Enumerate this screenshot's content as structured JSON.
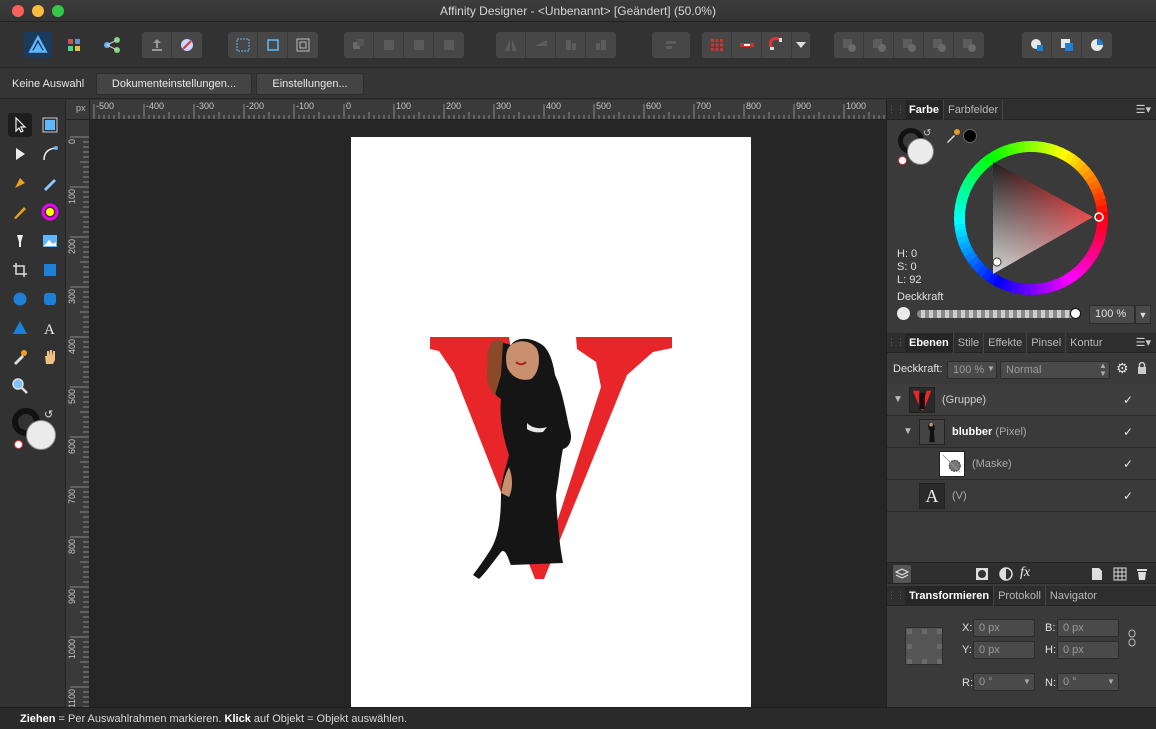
{
  "window": {
    "title": "Affinity Designer - <Unbenannt> [Geändert] (50.0%)"
  },
  "context_bar": {
    "selection_label": "Keine Auswahl",
    "doc_settings_button": "Dokumenteinstellungen...",
    "settings_button": "Einstellungen..."
  },
  "rulers": {
    "unit": "px",
    "top_ticks": [
      "-500",
      "-400",
      "-300",
      "-200",
      "-100",
      "0",
      "100",
      "200",
      "300",
      "400",
      "500",
      "600",
      "700",
      "800",
      "900",
      "1000"
    ],
    "left_ticks": [
      "0",
      "100",
      "200",
      "300",
      "400",
      "500",
      "600",
      "700",
      "800",
      "900",
      "1000",
      "1100"
    ]
  },
  "color_panel": {
    "tabs": [
      "Farbe",
      "Farbfelder"
    ],
    "h": "H: 0",
    "s": "S: 0",
    "l": "L: 92",
    "opacity_label": "Deckkraft",
    "opacity_value": "100 %"
  },
  "layers_panel": {
    "tabs": [
      "Ebenen",
      "Stile",
      "Effekte",
      "Pinsel",
      "Kontur"
    ],
    "opacity_label": "Deckkraft:",
    "opacity_value": "100 %",
    "blend_mode": "Normal",
    "layers": [
      {
        "name": "(Gruppe)",
        "bold": "",
        "type": ""
      },
      {
        "name": "",
        "bold": "blubber",
        "type": "(Pixel)"
      },
      {
        "name": "(Maske)",
        "bold": "",
        "type": ""
      },
      {
        "name": "(V)",
        "bold": "",
        "type": ""
      }
    ]
  },
  "transform_panel": {
    "tabs": [
      "Transformieren",
      "Protokoll",
      "Navigator"
    ],
    "x_label": "X:",
    "x_value": "0 px",
    "y_label": "Y:",
    "y_value": "0 px",
    "b_label": "B:",
    "b_value": "0 px",
    "h_label": "H:",
    "h_value": "0 px",
    "r_label": "R:",
    "r_value": "0 °",
    "n_label": "N:",
    "n_value": "0 °"
  },
  "status_bar": {
    "drag_bold": "Ziehen",
    "drag_text": " = Per Auswahlrahmen markieren. ",
    "click_bold": "Klick",
    "click_text": " auf Objekt = Objekt auswählen."
  },
  "colors": {
    "accent": "#1e7fd6",
    "letter_red": "#e8262a",
    "canvas_bg": "#262626"
  }
}
